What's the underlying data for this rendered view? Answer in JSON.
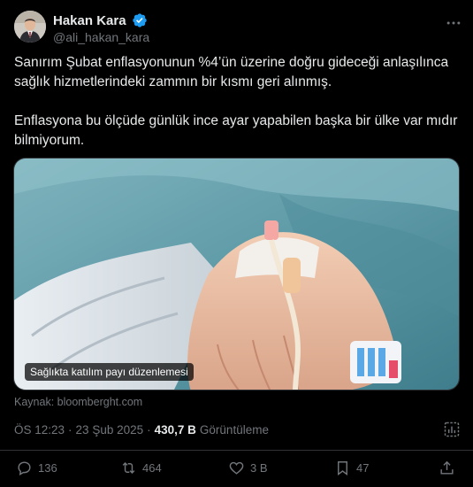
{
  "author": {
    "name": "Hakan Kara",
    "handle": "@ali_hakan_kara"
  },
  "tweet": {
    "paragraphs": [
      "Sanırım Şubat enflasyonunun %4’ün üzerine doğru gideceği anlaşılınca sağlık hizmetlerindeki zammın bir kısmı geri alınmış.",
      "Enflasyona bu ölçüde günlük ince ayar yapabilen başka bir ülke var mıdır bilmiyorum."
    ]
  },
  "media": {
    "caption": "Sağlıkta katılım payı düzenlemesi",
    "source": "Kaynak: bloomberght.com"
  },
  "meta": {
    "time": "ÖS 12:23",
    "separator": "·",
    "date": "23 Şub 2025",
    "views": "430,7 B",
    "views_label": "Görüntüleme"
  },
  "actions": {
    "replies": "136",
    "reposts": "464",
    "likes": "3 B",
    "bookmarks": "47"
  },
  "colors": {
    "background": "#000000",
    "text": "#e7e9ea",
    "muted": "#71767b",
    "verified": "#1d9bf0",
    "border": "#2f3336"
  },
  "icons": [
    "verified-badge-icon",
    "more-icon",
    "stats-icon",
    "reply-icon",
    "repost-icon",
    "like-icon",
    "bookmark-icon",
    "share-icon"
  ]
}
